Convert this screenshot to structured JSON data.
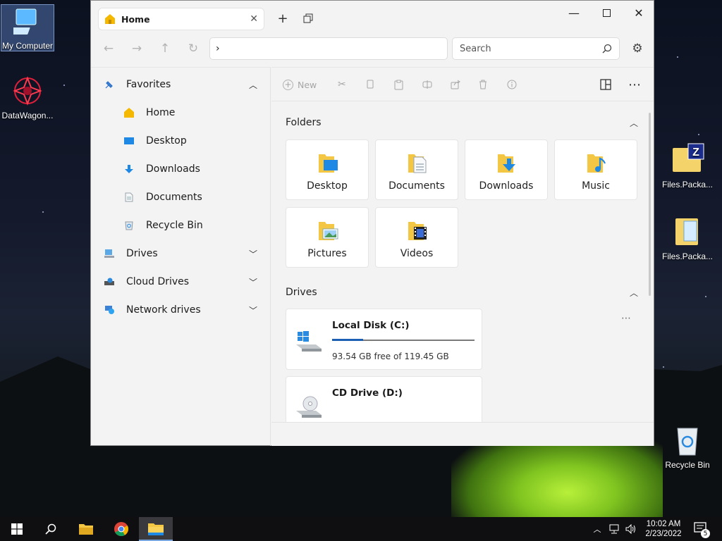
{
  "desktop": {
    "icons": [
      {
        "label": "My Computer"
      },
      {
        "label": "DataWagon..."
      },
      {
        "label": "Files.Packa..."
      },
      {
        "label": "Files.Packa..."
      },
      {
        "label": "Recycle Bin"
      }
    ]
  },
  "window": {
    "tab_title": "Home",
    "address_value": "",
    "search_placeholder": "Search"
  },
  "sidebar": {
    "items": [
      {
        "label": "Favorites"
      },
      {
        "label": "Home"
      },
      {
        "label": "Desktop"
      },
      {
        "label": "Downloads"
      },
      {
        "label": "Documents"
      },
      {
        "label": "Recycle Bin"
      },
      {
        "label": "Drives"
      },
      {
        "label": "Cloud Drives"
      },
      {
        "label": "Network drives"
      }
    ]
  },
  "toolbar": {
    "new_label": "New"
  },
  "folders": {
    "header": "Folders",
    "items": [
      {
        "label": "Desktop"
      },
      {
        "label": "Documents"
      },
      {
        "label": "Downloads"
      },
      {
        "label": "Music"
      },
      {
        "label": "Pictures"
      },
      {
        "label": "Videos"
      }
    ]
  },
  "drives": {
    "header": "Drives",
    "items": [
      {
        "name": "Local Disk (C:)",
        "free": "93.54 GB free of 119.45 GB",
        "used_fraction": 0.217
      },
      {
        "name": "CD Drive (D:)",
        "free": ""
      }
    ]
  },
  "taskbar": {
    "time": "10:02 AM",
    "date": "2/23/2022",
    "notifications": "5"
  },
  "colors": {
    "accent": "#1a5fb4",
    "folder": "#f3c744",
    "home": "#f5b800"
  }
}
